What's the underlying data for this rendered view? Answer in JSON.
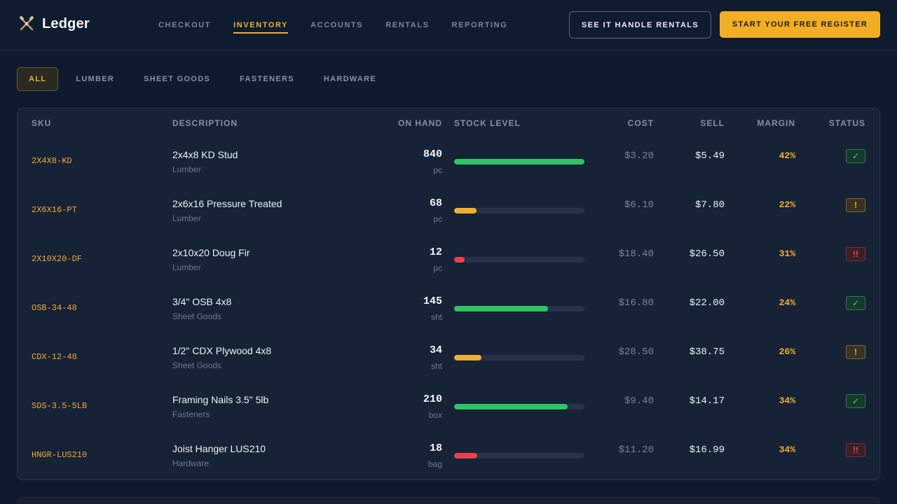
{
  "brand": {
    "name": "Ledger",
    "icon": "crossed-tools-icon"
  },
  "nav": [
    {
      "label": "CHECKOUT",
      "active": false
    },
    {
      "label": "INVENTORY",
      "active": true
    },
    {
      "label": "ACCOUNTS",
      "active": false
    },
    {
      "label": "RENTALS",
      "active": false
    },
    {
      "label": "REPORTING",
      "active": false
    }
  ],
  "header": {
    "secondary_cta": "SEE IT HANDLE RENTALS",
    "primary_cta": "START YOUR FREE REGISTER"
  },
  "filters": [
    {
      "label": "ALL",
      "active": true
    },
    {
      "label": "LUMBER",
      "active": false
    },
    {
      "label": "SHEET GOODS",
      "active": false
    },
    {
      "label": "FASTENERS",
      "active": false
    },
    {
      "label": "HARDWARE",
      "active": false
    }
  ],
  "table": {
    "columns": {
      "sku": "SKU",
      "description": "DESCRIPTION",
      "on_hand": "ON HAND",
      "stock_level": "STOCK LEVEL",
      "cost": "COST",
      "sell": "SELL",
      "margin": "MARGIN",
      "status": "STATUS"
    },
    "rows": [
      {
        "sku": "2X4X8-KD",
        "name": "2x4x8 KD Stud",
        "category": "Lumber",
        "qty": "840",
        "unit": "pc",
        "stock_pct": 100,
        "level": "ok",
        "cost": "$3.20",
        "sell": "$5.49",
        "margin": "42%",
        "status": "ok",
        "status_glyph": "✓"
      },
      {
        "sku": "2X6X16-PT",
        "name": "2x6x16 Pressure Treated",
        "category": "Lumber",
        "qty": "68",
        "unit": "pc",
        "stock_pct": 17,
        "level": "warn",
        "cost": "$6.10",
        "sell": "$7.80",
        "margin": "22%",
        "status": "warn",
        "status_glyph": "!"
      },
      {
        "sku": "2X10X20-DF",
        "name": "2x10x20 Doug Fir",
        "category": "Lumber",
        "qty": "12",
        "unit": "pc",
        "stock_pct": 8,
        "level": "crit",
        "cost": "$18.40",
        "sell": "$26.50",
        "margin": "31%",
        "status": "crit",
        "status_glyph": "!!"
      },
      {
        "sku": "OSB-34-48",
        "name": "3/4\" OSB 4x8",
        "category": "Sheet Goods",
        "qty": "145",
        "unit": "sht",
        "stock_pct": 72,
        "level": "ok",
        "cost": "$16.80",
        "sell": "$22.00",
        "margin": "24%",
        "status": "ok",
        "status_glyph": "✓"
      },
      {
        "sku": "CDX-12-48",
        "name": "1/2\" CDX Plywood 4x8",
        "category": "Sheet Goods",
        "qty": "34",
        "unit": "sht",
        "stock_pct": 21,
        "level": "warn",
        "cost": "$28.50",
        "sell": "$38.75",
        "margin": "26%",
        "status": "warn",
        "status_glyph": "!"
      },
      {
        "sku": "SDS-3.5-5LB",
        "name": "Framing Nails 3.5\" 5lb",
        "category": "Fasteners",
        "qty": "210",
        "unit": "box",
        "stock_pct": 87,
        "level": "ok",
        "cost": "$9.40",
        "sell": "$14.17",
        "margin": "34%",
        "status": "ok",
        "status_glyph": "✓"
      },
      {
        "sku": "HNGR-LUS210",
        "name": "Joist Hanger LUS210",
        "category": "Hardware",
        "qty": "18",
        "unit": "bag",
        "stock_pct": 18,
        "level": "crit",
        "cost": "$11.20",
        "sell": "$16.99",
        "margin": "34%",
        "status": "crit",
        "status_glyph": "!!"
      }
    ]
  },
  "colors": {
    "accent": "#f0b02f",
    "ok": "#2ec565",
    "warn": "#f0b02f",
    "crit": "#e8434c",
    "background": "#0e1a2e"
  }
}
